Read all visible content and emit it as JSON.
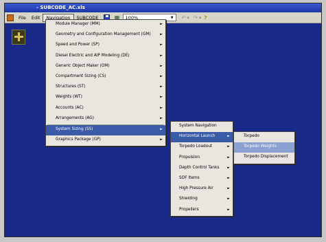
{
  "window": {
    "title": "- SUBCODE_AC.xls"
  },
  "menubar": {
    "items": [
      {
        "id": "file",
        "label": "File"
      },
      {
        "id": "edit",
        "label": "Edit"
      },
      {
        "id": "navigation",
        "label": "Navigation"
      },
      {
        "id": "subcode",
        "label": "SUBCODE"
      }
    ],
    "zoom": "100%"
  },
  "navigation_menu": {
    "items": [
      "Module Manager (MM)",
      "Geometry and Configuration Management (GM)",
      "Speed and Power (SP)",
      "Diesel Electric and AIP Modeling (DE)",
      "Generic Object Maker (OM)",
      "Compartment Sizing (CS)",
      "Structures (ST)",
      "Weights (WT)",
      "Accounts (AC)",
      "Arrangements (AG)",
      "System Sizing (SS)",
      "Graphics Package (GP)"
    ],
    "highlighted": "System Sizing (SS)"
  },
  "system_sizing_menu": {
    "items": [
      "System Navigation",
      "Horizontal Launch",
      "Torpedo Loadout",
      "Propulsion",
      "Depth Control Tanks",
      "SOF Items",
      "High Pressure Air",
      "Shielding",
      "Propellers"
    ],
    "highlighted": "Horizontal Launch"
  },
  "horizontal_launch_menu": {
    "items": [
      "Torpedo",
      "Torpedo Weights",
      "Torpedo Displacement"
    ],
    "highlighted": "Torpedo Weights"
  },
  "colors": {
    "workspace": "#1a2a8a",
    "highlight": "#3b5aa8",
    "menu_bg": "#e8e6de"
  }
}
